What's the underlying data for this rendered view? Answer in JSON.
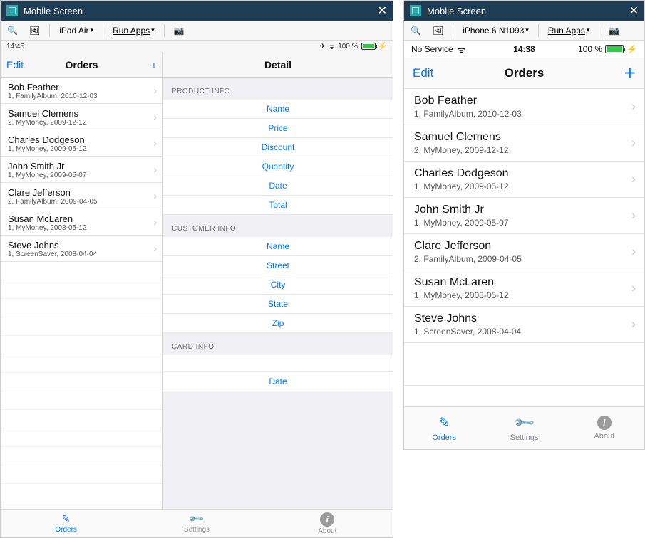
{
  "window": {
    "title": "Mobile Screen",
    "close": "✕"
  },
  "toolbar": {
    "device1": "iPad Air",
    "device2": "iPhone 6 N1093",
    "runapps": "Run Apps"
  },
  "ipad": {
    "statusbar": {
      "time": "14:45",
      "battery": "100 %",
      "airplane": "✈",
      "wifi": "ᯤ",
      "bolt": "⚡"
    },
    "master": {
      "edit": "Edit",
      "title": "Orders",
      "add": "+"
    },
    "detail": {
      "title": "Detail",
      "sections": {
        "product": {
          "header": "PRODUCT INFO",
          "fields": [
            "Name",
            "Price",
            "Discount",
            "Quantity",
            "Date",
            "Total"
          ]
        },
        "customer": {
          "header": "CUSTOMER INFO",
          "fields": [
            "Name",
            "Street",
            "City",
            "State",
            "Zip"
          ]
        },
        "card": {
          "header": "CARD INFO",
          "fields": [
            "",
            "Date"
          ]
        }
      }
    },
    "tabs": {
      "orders": "Orders",
      "settings": "Settings",
      "about": "About"
    }
  },
  "iphone": {
    "statusbar": {
      "carrier": "No Service",
      "wifi": "ᯤ",
      "time": "14:38",
      "battery": "100 %",
      "bolt": "⚡"
    },
    "nav": {
      "edit": "Edit",
      "title": "Orders",
      "add": "+"
    },
    "tabs": {
      "orders": "Orders",
      "settings": "Settings",
      "about": "About"
    }
  },
  "orders": [
    {
      "name": "Bob Feather",
      "sub": "1, FamilyAlbum, 2010-12-03"
    },
    {
      "name": "Samuel Clemens",
      "sub": "2, MyMoney, 2009-12-12"
    },
    {
      "name": "Charles Dodgeson",
      "sub": "1, MyMoney, 2009-05-12"
    },
    {
      "name": "John Smith Jr",
      "sub": "1, MyMoney, 2009-05-07"
    },
    {
      "name": "Clare Jefferson",
      "sub": "2, FamilyAlbum, 2009-04-05"
    },
    {
      "name": "Susan McLaren",
      "sub": "1, MyMoney, 2008-05-12"
    },
    {
      "name": "Steve Johns",
      "sub": "1, ScreenSaver, 2008-04-04"
    }
  ]
}
